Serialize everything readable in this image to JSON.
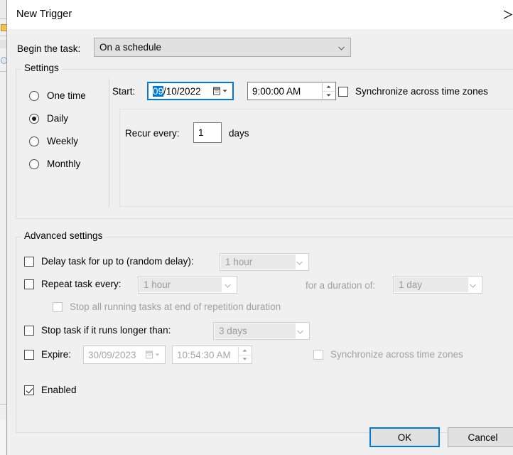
{
  "window": {
    "title": "New Trigger",
    "close_icon": "close-x-icon"
  },
  "begin_task": {
    "label": "Begin the task:",
    "value": "On a schedule",
    "arrow_icon": "chevron-down-icon"
  },
  "settings": {
    "group_label": "Settings",
    "schedule_options": [
      {
        "label": "One time",
        "selected": false
      },
      {
        "label": "Daily",
        "selected": true
      },
      {
        "label": "Weekly",
        "selected": false
      },
      {
        "label": "Monthly",
        "selected": false
      }
    ],
    "start": {
      "label": "Start:",
      "date_value": "09/10/2022",
      "date_selected_part": "09",
      "date_rest": "/10/2022",
      "date_picker_icon": "calendar-dropdown-icon",
      "time_value": "9:00:00 AM",
      "spinner_icon": "spinner-up-down-icon"
    },
    "sync_time_zones": {
      "label": "Synchronize across time zones",
      "checked": false
    },
    "recur": {
      "label": "Recur every:",
      "value": "1",
      "unit": "days"
    }
  },
  "advanced": {
    "group_label": "Advanced settings",
    "delay_task": {
      "label": "Delay task for up to (random delay):",
      "checked": false,
      "value": "1 hour"
    },
    "repeat_task": {
      "label": "Repeat task every:",
      "checked": false,
      "value": "1 hour",
      "duration_label": "for a duration of:",
      "duration_value": "1 day"
    },
    "stop_all_running": {
      "label": "Stop all running tasks at end of repetition duration",
      "checked": false,
      "disabled": true
    },
    "stop_task_longer": {
      "label": "Stop task if it runs longer than:",
      "checked": false,
      "value": "3 days"
    },
    "expire": {
      "label": "Expire:",
      "checked": false,
      "date_value": "30/09/2023",
      "time_value": "10:54:30 AM",
      "date_picker_icon": "calendar-dropdown-icon",
      "spinner_icon": "spinner-up-down-icon"
    },
    "expire_sync_time_zones": {
      "label": "Synchronize across time zones",
      "checked": false,
      "disabled": true
    },
    "enabled": {
      "label": "Enabled",
      "checked": true
    }
  },
  "footer": {
    "ok_label": "OK",
    "cancel_label": "Cancel"
  },
  "colors": {
    "accent": "#0078d7",
    "dialog_bg": "#f0f0f0",
    "titlebar_bg": "#ffffff",
    "disabled_text": "#a0a0a0"
  }
}
